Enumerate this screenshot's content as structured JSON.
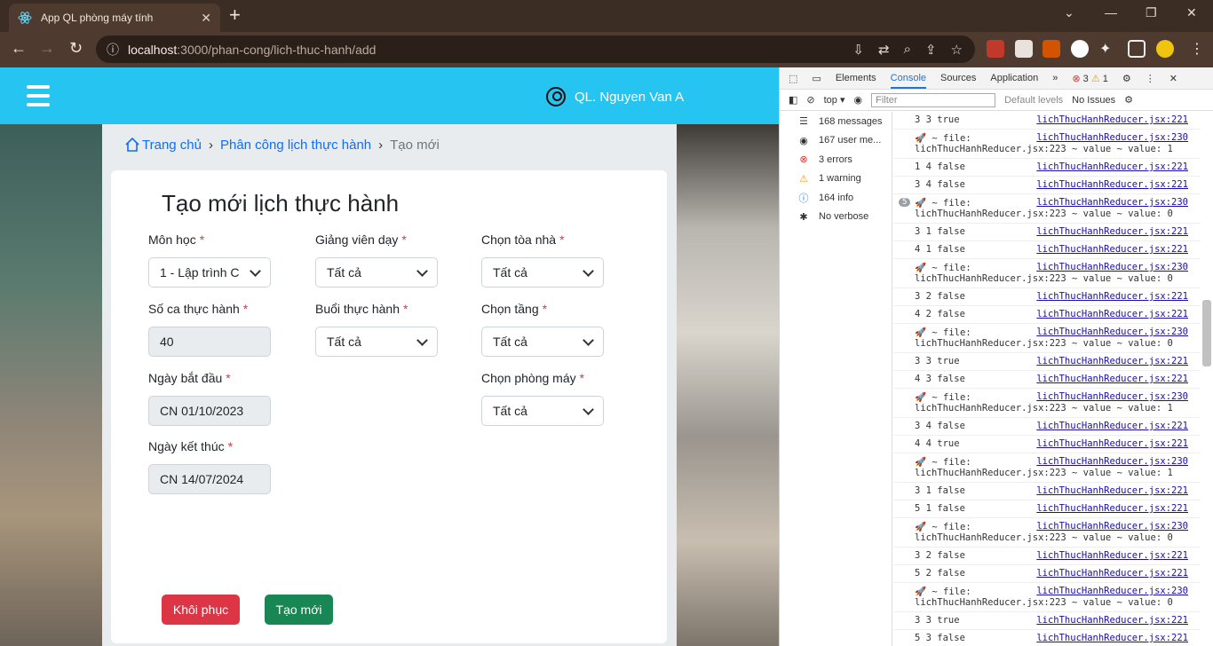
{
  "browser": {
    "tab_title": "App QL phòng máy tính",
    "url_host": "localhost",
    "url_rest": ":3000/phan-cong/lich-thuc-hanh/add"
  },
  "appbar": {
    "user_name": "QL. Nguyen Van A"
  },
  "breadcrumb": {
    "home": "Trang chủ",
    "section": "Phân công lịch thực hành",
    "current": "Tạo mới"
  },
  "form": {
    "title": "Tạo mới lịch thực hành",
    "mon_hoc": {
      "label": "Môn học",
      "value": "1 - Lập trình C"
    },
    "giang_vien": {
      "label": "Giảng viên dạy",
      "value": "Tất cả"
    },
    "toa_nha": {
      "label": "Chọn tòa nhà",
      "value": "Tất cả"
    },
    "so_ca": {
      "label": "Số ca thực hành",
      "value": "40"
    },
    "buoi": {
      "label": "Buổi thực hành",
      "value": "Tất cả"
    },
    "tang": {
      "label": "Chọn tầng",
      "value": "Tất cả"
    },
    "ngay_bat_dau": {
      "label": "Ngày bắt đầu",
      "value": "CN 01/10/2023"
    },
    "phong_may": {
      "label": "Chọn phòng máy",
      "value": "Tất cả"
    },
    "ngay_ket_thuc": {
      "label": "Ngày kết thúc",
      "value": "CN 14/07/2024"
    },
    "required_mark": "*",
    "reset_label": "Khôi phục",
    "create_label": "Tạo mới"
  },
  "devtools": {
    "tabs": [
      "Elements",
      "Console",
      "Sources",
      "Application"
    ],
    "errors": "3",
    "warnings": "1",
    "context": "top",
    "filter_placeholder": "Filter",
    "levels": "Default levels",
    "issues": "No Issues",
    "sidebar": [
      {
        "icon": "list-icon",
        "text": "168 messages"
      },
      {
        "icon": "user-icon",
        "text": "167 user me..."
      },
      {
        "icon": "error-icon",
        "text": "3 errors"
      },
      {
        "icon": "warning-icon",
        "text": "1 warning"
      },
      {
        "icon": "info-icon",
        "text": "164 info"
      },
      {
        "icon": "bug-icon",
        "text": "No verbose"
      }
    ],
    "logs": [
      {
        "text": "3 3 true",
        "src": "lichThucHanhReducer.jsx:221"
      },
      {
        "text": "🚀 ~ file:",
        "text2": "lichThucHanhReducer.jsx:223 ~ value ~ value: 1",
        "src": "lichThucHanhReducer.jsx:230"
      },
      {
        "text": "1 4 false",
        "src": "lichThucHanhReducer.jsx:221"
      },
      {
        "text": "3 4 false",
        "src": "lichThucHanhReducer.jsx:221"
      },
      {
        "text": "🚀 ~ file:",
        "text2": "lichThucHanhReducer.jsx:223 ~ value ~ value: 0",
        "src": "lichThucHanhReducer.jsx:230",
        "count": "5"
      },
      {
        "text": "3 1 false",
        "src": "lichThucHanhReducer.jsx:221"
      },
      {
        "text": "4 1 false",
        "src": "lichThucHanhReducer.jsx:221"
      },
      {
        "text": "🚀 ~ file:",
        "text2": "lichThucHanhReducer.jsx:223 ~ value ~ value: 0",
        "src": "lichThucHanhReducer.jsx:230"
      },
      {
        "text": "3 2 false",
        "src": "lichThucHanhReducer.jsx:221"
      },
      {
        "text": "4 2 false",
        "src": "lichThucHanhReducer.jsx:221"
      },
      {
        "text": "🚀 ~ file:",
        "text2": "lichThucHanhReducer.jsx:223 ~ value ~ value: 0",
        "src": "lichThucHanhReducer.jsx:230"
      },
      {
        "text": "3 3 true",
        "src": "lichThucHanhReducer.jsx:221"
      },
      {
        "text": "4 3 false",
        "src": "lichThucHanhReducer.jsx:221"
      },
      {
        "text": "🚀 ~ file:",
        "text2": "lichThucHanhReducer.jsx:223 ~ value ~ value: 1",
        "src": "lichThucHanhReducer.jsx:230"
      },
      {
        "text": "3 4 false",
        "src": "lichThucHanhReducer.jsx:221"
      },
      {
        "text": "4 4 true",
        "src": "lichThucHanhReducer.jsx:221"
      },
      {
        "text": "🚀 ~ file:",
        "text2": "lichThucHanhReducer.jsx:223 ~ value ~ value: 1",
        "src": "lichThucHanhReducer.jsx:230"
      },
      {
        "text": "3 1 false",
        "src": "lichThucHanhReducer.jsx:221"
      },
      {
        "text": "5 1 false",
        "src": "lichThucHanhReducer.jsx:221"
      },
      {
        "text": "🚀 ~ file:",
        "text2": "lichThucHanhReducer.jsx:223 ~ value ~ value: 0",
        "src": "lichThucHanhReducer.jsx:230"
      },
      {
        "text": "3 2 false",
        "src": "lichThucHanhReducer.jsx:221"
      },
      {
        "text": "5 2 false",
        "src": "lichThucHanhReducer.jsx:221"
      },
      {
        "text": "🚀 ~ file:",
        "text2": "lichThucHanhReducer.jsx:223 ~ value ~ value: 0",
        "src": "lichThucHanhReducer.jsx:230"
      },
      {
        "text": "3 3 true",
        "src": "lichThucHanhReducer.jsx:221"
      },
      {
        "text": "5 3 false",
        "src": "lichThucHanhReducer.jsx:221"
      }
    ]
  }
}
